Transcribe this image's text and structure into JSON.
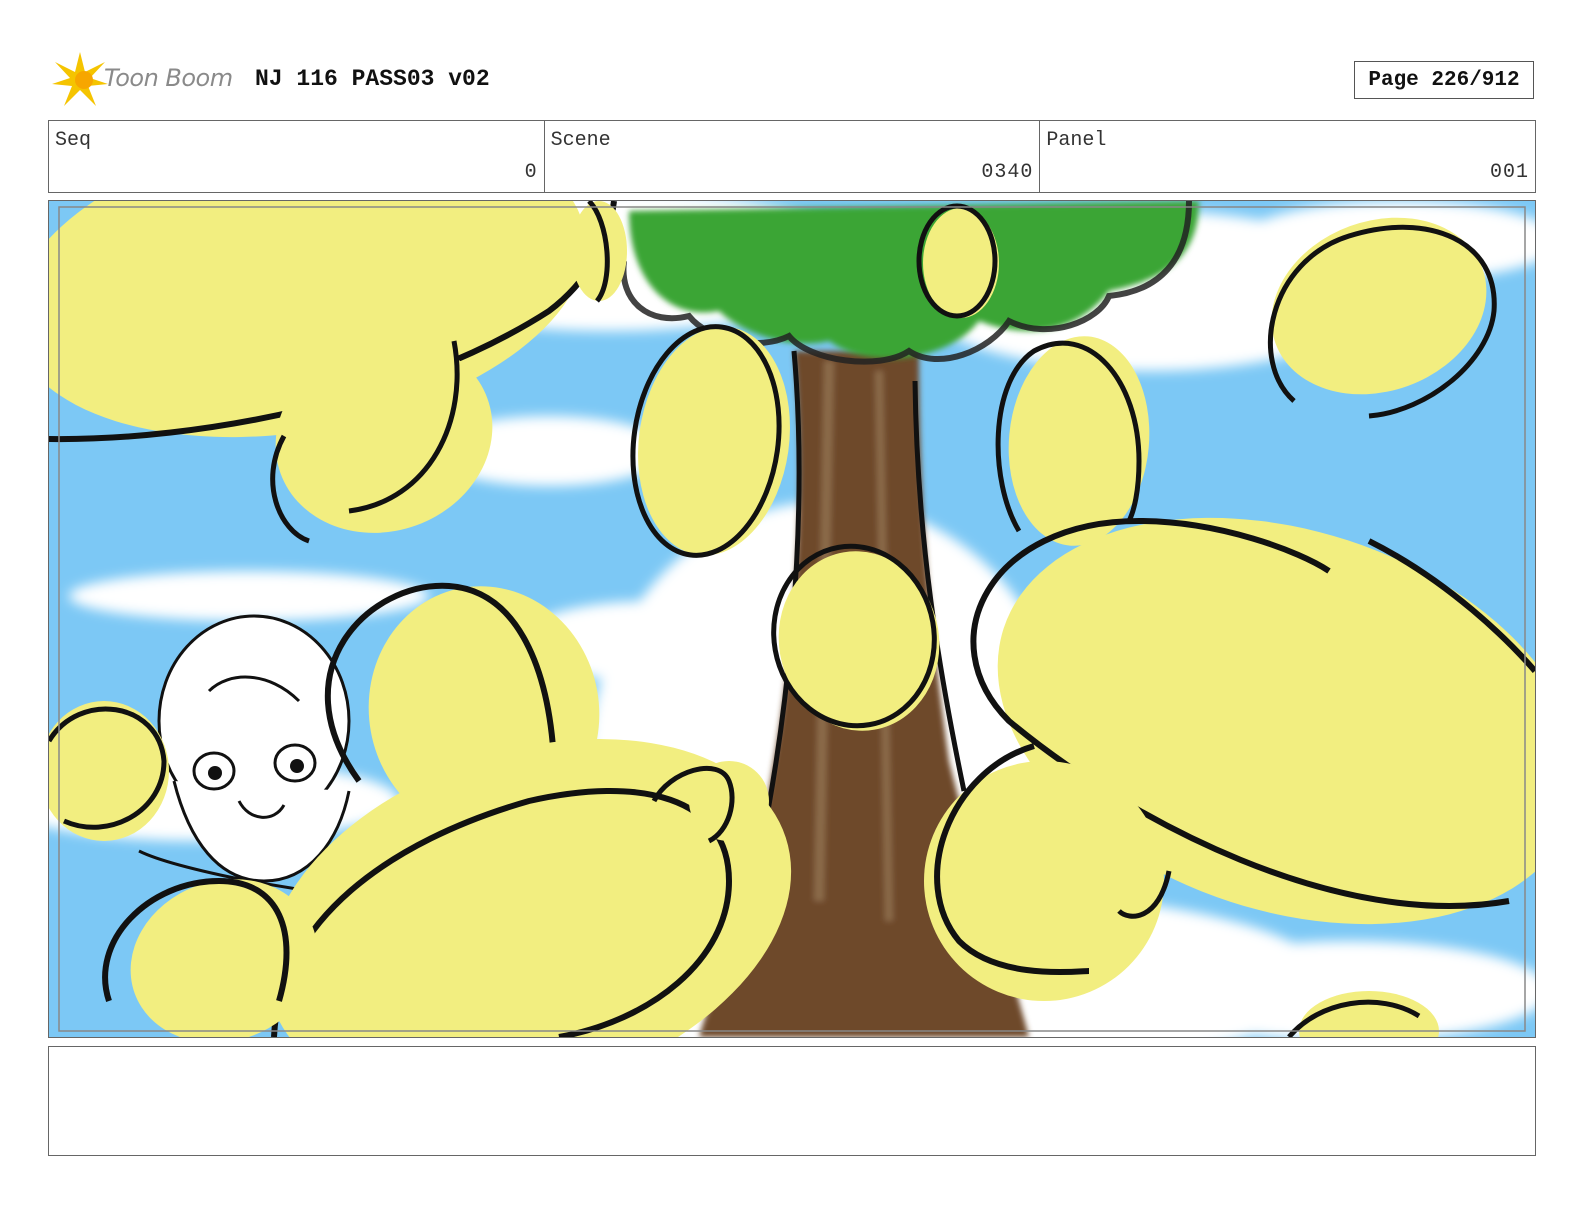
{
  "header": {
    "logo_text": "Toon Boom",
    "title": "NJ 116 PASS03 v02",
    "page_label": "Page 226/912"
  },
  "info": {
    "seq_label": "Seq",
    "seq_value": "0",
    "scene_label": "Scene",
    "scene_value": "0340",
    "panel_label": "Panel",
    "panel_value": "001"
  },
  "colors": {
    "sky": "#7cc8f5",
    "balloon": "#f2ee80",
    "leaves": "#3aa535",
    "trunk": "#6e4a2a",
    "outline": "#111111"
  },
  "notes": ""
}
